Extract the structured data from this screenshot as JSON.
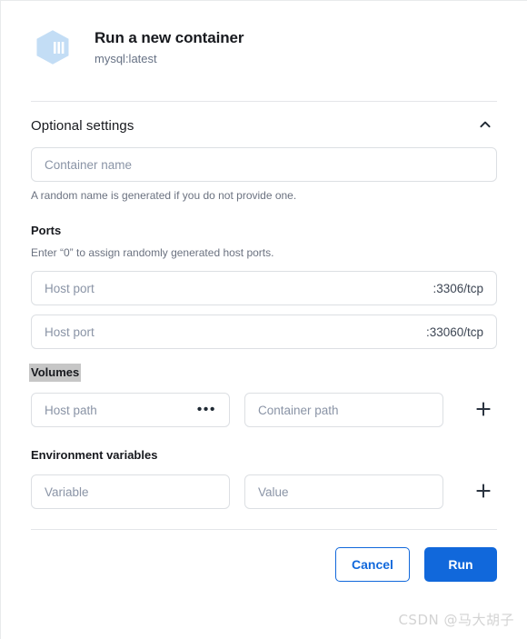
{
  "header": {
    "icon": "container-cube-icon",
    "title": "Run a new container",
    "subtitle": "mysql:latest"
  },
  "optional_settings": {
    "heading": "Optional settings",
    "collapse_icon": "chevron-up-icon",
    "container_name": {
      "placeholder": "Container name",
      "helper": "A random name is generated if you do not provide one."
    },
    "ports": {
      "label": "Ports",
      "helper": "Enter “0” to assign randomly generated host ports.",
      "rows": [
        {
          "placeholder": "Host port",
          "suffix": ":3306/tcp"
        },
        {
          "placeholder": "Host port",
          "suffix": ":33060/tcp"
        }
      ]
    },
    "volumes": {
      "label": "Volumes",
      "selected": true,
      "host_path_placeholder": "Host path",
      "browse_icon": "ellipsis-icon",
      "browse_label": "•••",
      "container_path_placeholder": "Container path",
      "add_icon": "plus-icon"
    },
    "environment_variables": {
      "label": "Environment variables",
      "variable_placeholder": "Variable",
      "value_placeholder": "Value",
      "add_icon": "plus-icon"
    }
  },
  "footer": {
    "cancel_label": "Cancel",
    "run_label": "Run"
  },
  "watermark": {
    "text": "CSDN @马大胡子"
  },
  "colors": {
    "accent_blue": "#1168db",
    "icon_blue": "#c3ddf5",
    "text_primary": "#17191e",
    "text_muted": "#677285",
    "placeholder": "#8a94a6",
    "border": "#dcdfe3",
    "divider": "#e4e6e9",
    "selection": "#c6c6c6"
  }
}
